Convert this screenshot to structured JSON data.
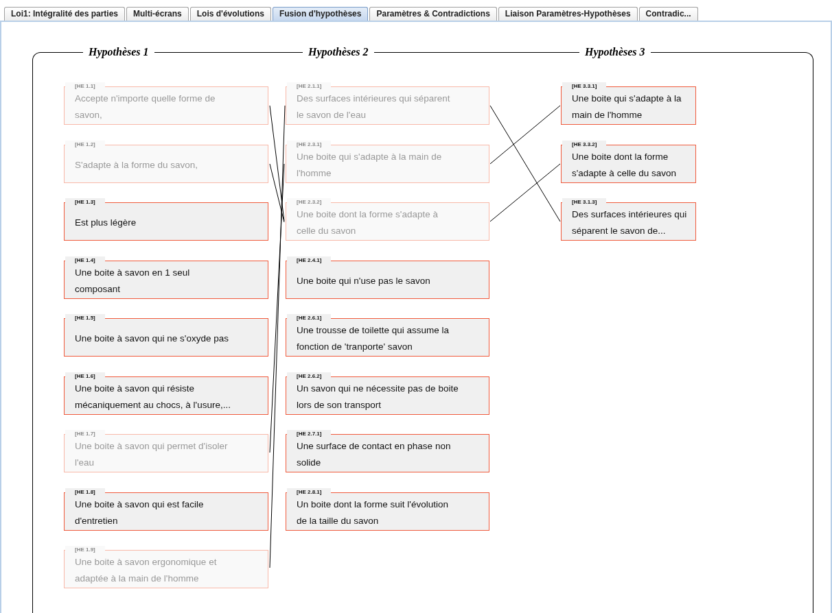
{
  "tabs": [
    {
      "label": "Loi1: Intégralité des parties",
      "selected": false
    },
    {
      "label": "Multi-écrans",
      "selected": false
    },
    {
      "label": "Lois d'évolutions",
      "selected": false
    },
    {
      "label": "Fusion d'hypothèses",
      "selected": true
    },
    {
      "label": "Paramètres & Contradictions",
      "selected": false
    },
    {
      "label": "Liaison Paramètres-Hypothèses",
      "selected": false
    },
    {
      "label": "Contradic...",
      "selected": false
    }
  ],
  "columns": [
    {
      "title": "Hypothèses 1",
      "cards": [
        {
          "label": "[HE 1.1]",
          "text": "Accepte n'importe quelle forme de savon,",
          "dimmed": true
        },
        {
          "label": "[HE 1.2]",
          "text": "S'adapte à la forme du savon,",
          "dimmed": true
        },
        {
          "label": "[HE 1.3]",
          "text": "Est plus légère",
          "dimmed": false
        },
        {
          "label": "[HE 1.4]",
          "text": "Une boite à savon en 1 seul composant",
          "dimmed": false
        },
        {
          "label": "[HE 1.5]",
          "text": "Une boite à savon qui ne s'oxyde pas",
          "dimmed": false
        },
        {
          "label": "[HE 1.6]",
          "text": "Une boite à savon qui résiste mécaniquement au chocs, à l'usure,...",
          "dimmed": false
        },
        {
          "label": "[HE 1.7]",
          "text": "Une boite à savon qui permet d'isoler l'eau",
          "dimmed": true
        },
        {
          "label": "[HE 1.8]",
          "text": "Une boite à savon qui est facile d'entretien",
          "dimmed": false
        },
        {
          "label": "[HE 1.9]",
          "text": "Une boite à savon ergonomique et adaptée à la main de l'homme",
          "dimmed": true
        }
      ]
    },
    {
      "title": "Hypothèses 2",
      "cards": [
        {
          "label": "[HE 2.1.1]",
          "text": "Des surfaces intérieures qui séparent le savon de l'eau",
          "dimmed": true
        },
        {
          "label": "[HE 2.3.1]",
          "text": "Une boite qui s'adapte à la main de l'homme",
          "dimmed": true
        },
        {
          "label": "[HE 2.3.2]",
          "text": "Une boite dont la forme s'adapte à celle du savon",
          "dimmed": true
        },
        {
          "label": "[HE 2.4.1]",
          "text": "Une boite qui n'use pas le savon",
          "dimmed": false
        },
        {
          "label": "[HE 2.6.1]",
          "text": "Une trousse de toilette qui assume la fonction de 'tranporte' savon",
          "dimmed": false
        },
        {
          "label": "[HE 2.6.2]",
          "text": "Un savon qui ne nécessite pas de boite lors de son transport",
          "dimmed": false
        },
        {
          "label": "[HE 2.7.1]",
          "text": "Une surface de contact en phase non solide",
          "dimmed": false
        },
        {
          "label": "[HE 2.8.1]",
          "text": "Un boite dont la forme suit l'évolution de la taille du savon",
          "dimmed": false
        }
      ]
    },
    {
      "title": "Hypothèses 3",
      "cards": [
        {
          "label": "[HE 3.3.1]",
          "text": "Une boite qui s'adapte à la main de l'homme",
          "dimmed": false
        },
        {
          "label": "[HE 3.3.2]",
          "text": "Une boite dont la forme s'adapte à celle du savon",
          "dimmed": false
        },
        {
          "label": "[HE 3.1.3]",
          "text": "Des surfaces intérieures qui séparent le savon de...",
          "dimmed": false
        }
      ]
    }
  ]
}
